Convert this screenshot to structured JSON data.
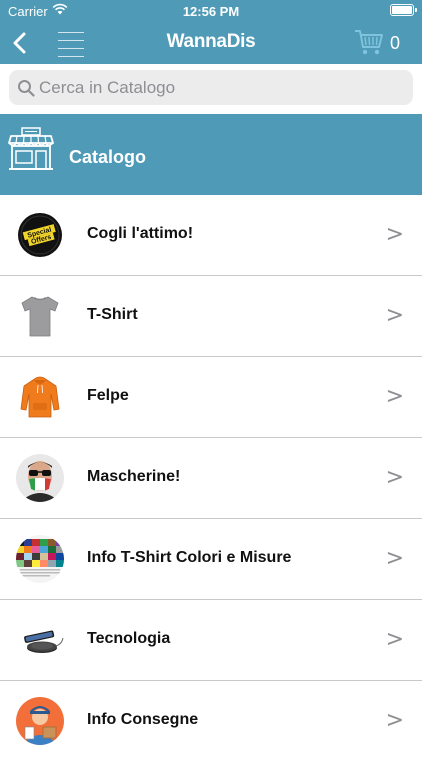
{
  "status_bar": {
    "carrier": "Carrier",
    "time": "12:56 PM"
  },
  "nav": {
    "title": "WannaDis",
    "cart_count": "0",
    "icons": [
      "back-chevron-icon",
      "hamburger-menu-icon",
      "cart-icon"
    ]
  },
  "search": {
    "placeholder": "Cerca in Catalogo",
    "value": ""
  },
  "banner": {
    "title": "Catalogo",
    "icon": "store-icon"
  },
  "list": {
    "chevron": ">",
    "items": [
      {
        "label": "Cogli l'attimo!",
        "icon": "special-offers-badge-icon"
      },
      {
        "label": "T-Shirt",
        "icon": "tshirt-icon"
      },
      {
        "label": "Felpe",
        "icon": "hoodie-icon"
      },
      {
        "label": "Mascherine!",
        "icon": "mask-person-icon"
      },
      {
        "label": "Info T-Shirt Colori e Misure",
        "icon": "color-swatches-icon"
      },
      {
        "label": "Tecnologia",
        "icon": "wireless-charger-icon"
      },
      {
        "label": "Info Consegne",
        "icon": "delivery-person-icon"
      }
    ]
  },
  "colors": {
    "accent": "#4f9ab6",
    "separator": "#c8c8cc",
    "search_bg": "#ececed"
  }
}
